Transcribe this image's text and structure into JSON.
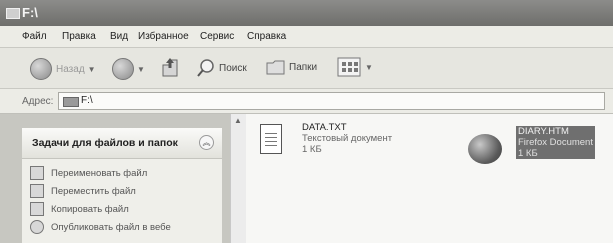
{
  "window": {
    "title": "F:\\"
  },
  "menu": [
    "Файл",
    "Правка",
    "Вид",
    "Избранное",
    "Сервис",
    "Справка"
  ],
  "toolbar": {
    "back_label": "Назад",
    "search_label": "Поиск",
    "folders_label": "Папки"
  },
  "address": {
    "label": "Адрес:",
    "value": "F:\\"
  },
  "tasks": {
    "title": "Задачи для файлов и папок",
    "items": [
      {
        "label": "Переименовать файл",
        "icon": "rename-icon"
      },
      {
        "label": "Переместить файл",
        "icon": "move-icon"
      },
      {
        "label": "Копировать файл",
        "icon": "copy-icon"
      },
      {
        "label": "Опубликовать файл в вебе",
        "icon": "publish-web-icon"
      }
    ]
  },
  "files": [
    {
      "name": "DATA.TXT",
      "type": "Текстовый документ",
      "size": "1 КБ",
      "icon": "text-document-icon",
      "selected": false
    },
    {
      "name": "DIARY.HTM",
      "type": "Firefox Document",
      "size": "1 КБ",
      "icon": "firefox-document-icon",
      "selected": true
    }
  ]
}
